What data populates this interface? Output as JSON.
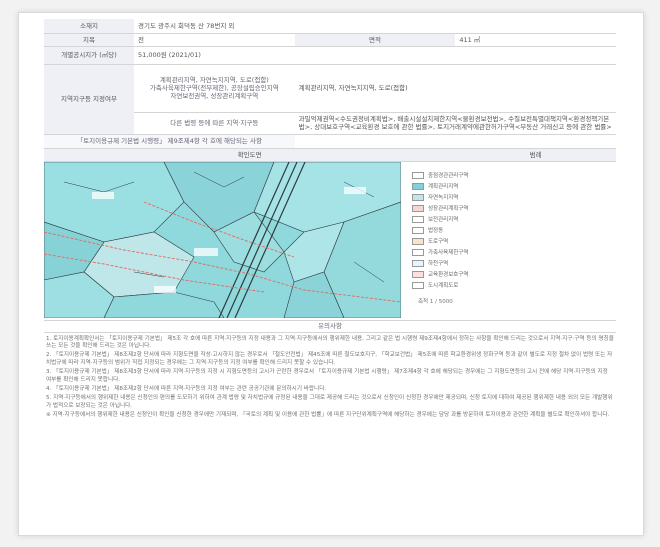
{
  "document": {
    "rows": [
      {
        "label": "소재지",
        "value": "경기도 광주시 회덕동 산 78번지 외"
      },
      {
        "label": "지목",
        "value": "전",
        "label2": "면적",
        "value2": "411 ㎡"
      },
      {
        "label": "개별공시지가 (㎡당)",
        "value": "51,000원 (2021/01)"
      }
    ],
    "regulation": {
      "label": "지역지구등 지정여부",
      "law_items": [
        "계획관리지역, 자연녹지지역, 도로(접함)",
        "가축사육제한구역(전부제한), 공장설립승인지역",
        "자연보전권역, 성장관리계획구역"
      ],
      "other_law_label": "다른 법령 등에 따른 지역·지구등",
      "other_law_value": "과밀억제권역<수도권정비계획법>, 배출시설설치제한지역<물환경보전법>, 수질보전특별대책지역<환경정책기본법>, 상대보호구역<교육환경 보호에 관한 법률>, 토지거래계약에관한허가구역<부동산 거래신고 등에 관한 법률>",
      "extra_label": "「토지이용규제 기본법 시행령」 제9조제4항 각 호에 해당되는 사항",
      "extra_value": ""
    },
    "map_header": "확인도면",
    "legend_header": "범례",
    "legend": [
      {
        "label": "중점경관관리구역",
        "color": "#ffffff"
      },
      {
        "label": "계획관리지역",
        "color": "#7fd3d8"
      },
      {
        "label": "자연녹지지역",
        "color": "#bfe6e8"
      },
      {
        "label": "성장관리계획구역",
        "color": "#f4d6d6"
      },
      {
        "label": "보전관리지역",
        "color": "#ffffff"
      },
      {
        "label": "법정동",
        "color": "#ffffff"
      },
      {
        "label": "도로구역",
        "color": "#f7e4c8"
      },
      {
        "label": "가축사육제한구역",
        "color": "#ffffff"
      },
      {
        "label": "하천구역",
        "color": "#e9f4ff"
      },
      {
        "label": "교육환경보호구역",
        "color": "#ffe0e0"
      },
      {
        "label": "도시계획도로",
        "color": "#ffffff"
      }
    ],
    "scale": "축척 1 / 5000",
    "confirm_title": "유의사항",
    "notes": [
      "1. 토지이용계획확인서는 「토지이용규제 기본법」 제5조 각 호에 따른 지역·지구등의 지정 내용과 그 지역·지구등에서의 행위제한 내용, 그리고 같은 법 시행령 제9조제4항에서 정하는 사항을 확인해 드리는 것으로서 지역·지구·구역 등의 명칭을 쓰는 모든 것을 확인해 드리는 것은 아닙니다.",
      "2. 「토지이용규제 기본법」 제8조제2항 단서에 따라 지형도면을 작성·고시하지 않는 경우로서 「철도안전법」 제45조에 따른 철도보호지구, 「학교보건법」 제5조에 따른 학교환경위생 정화구역 등과 같이 별도로 지정 절차 없이 법령 또는 자치법규에 따라 지역·지구등의 범위가 직접 지정되는 경우에는 그 지역·지구등의 지정 여부를 확인해 드리지 못할 수 있습니다.",
      "3. 「토지이용규제 기본법」 제8조제3항 단서에 따라 지역·지구등의 지정 시 지형도면등의 고시가 곤란한 경우로서 「토지이용규제 기본법 시행령」 제7조제4항 각 호에 해당되는 경우에는 그 지형도면등의 고시 전에 해당 지역·지구등의 지정 여부를 확인해 드리지 못합니다.",
      "4. 「토지이용규제 기본법」 제8조제2항 단서에 따른 지역·지구등의 지정 여부는 관련 공공기관에 문의하시기 바랍니다.",
      "5. 지역·지구등에서의 행위제한 내용은 신청인의 편의를 도모하기 위하여 관계 법령 및 자치법규에 규정된 내용을 그대로 제공해 드리는 것으로서 신청인이 신청한 경우에만 제공되며, 신청 토지에 대하여 제공된 행위제한 내용 외의 모든 개발행위가 법적으로 보장되는 것은 아닙니다.",
      "※ 지역·지구등에서의 행위제한 내용은 신청인이 확인을 신청한 경우에만 기재되며, 「국토의 계획 및 이용에 관한 법률」에 따른 지구단위계획구역에 해당하는 경우에는 담당 과를 방문하여 토지이용과 관련한 계획을 별도로 확인하셔야 합니다."
    ]
  },
  "colors": {
    "map_base": "#8fd8dc",
    "map_road": "#e26a5e",
    "map_line": "#2c3c40",
    "header_bg": "#eef0f6"
  }
}
